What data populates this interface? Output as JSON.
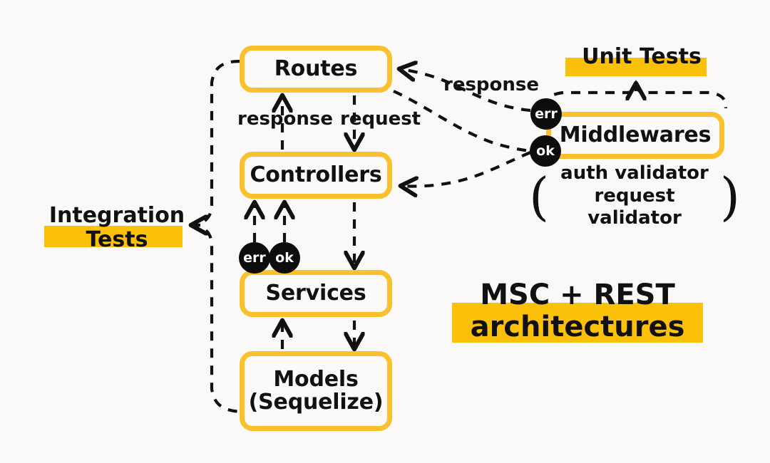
{
  "diagram": {
    "title": "MSC + REST architectures",
    "background_color": "#faf9f7",
    "accent_color": "#fbc00a",
    "box_border_color": "#fbc02d",
    "badge_color": "#0d0d0d",
    "text_color": "#111111"
  },
  "nodes": [
    {
      "id": "routes",
      "label": "Routes"
    },
    {
      "id": "controllers",
      "label": "Controllers"
    },
    {
      "id": "services",
      "label": "Services"
    },
    {
      "id": "models",
      "label": "Models\n(Sequelize)"
    },
    {
      "id": "middlewares",
      "label": "Middlewares"
    }
  ],
  "badges": [
    {
      "id": "err-services",
      "label": "err"
    },
    {
      "id": "ok-services",
      "label": "ok"
    },
    {
      "id": "err-mw",
      "label": "err"
    },
    {
      "id": "ok-mw",
      "label": "ok"
    }
  ],
  "edge_labels": {
    "response_left": "response",
    "request": "request",
    "response_right": "response"
  },
  "callouts": {
    "unit_tests": "Unit Tests",
    "integration_tests_line1": "Integration",
    "integration_tests_line2": "Tests",
    "title_line1": "MSC + REST",
    "title_line2": "architectures"
  },
  "validators": {
    "open_paren": "(",
    "close_paren": ")",
    "line1": "auth validator",
    "line2": "request validator"
  }
}
